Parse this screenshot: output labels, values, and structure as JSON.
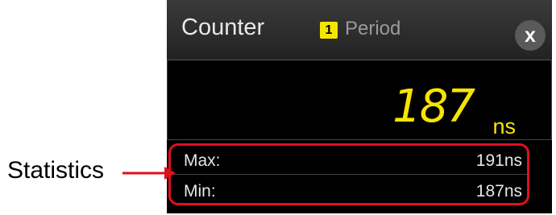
{
  "counter_panel": {
    "title": "Counter",
    "channel_badge": "1",
    "measurement_type": "Period",
    "close_label": "x",
    "value": "187",
    "unit": "ns",
    "statistics": [
      {
        "label": "Max:",
        "value": "191ns"
      },
      {
        "label": "Min:",
        "value": "187ns"
      }
    ]
  },
  "annotation": {
    "label": "Statistics",
    "arrow_color": "#e0101a"
  },
  "colors": {
    "value_yellow": "#f5e500",
    "badge_yellow": "#f2e600",
    "highlight_red": "#e0101a"
  }
}
